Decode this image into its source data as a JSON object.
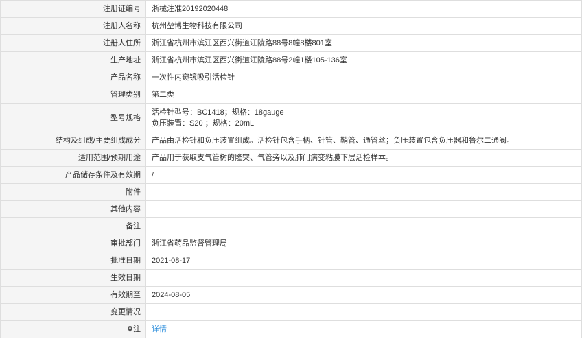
{
  "rows": [
    {
      "label": "注册证编号",
      "value": "浙械注准20192020448"
    },
    {
      "label": "注册人名称",
      "value": "杭州堃博生物科技有限公司"
    },
    {
      "label": "注册人住所",
      "value": "浙江省杭州市滨江区西兴街道江陵路88号8幢8楼801室"
    },
    {
      "label": "生产地址",
      "value": "浙江省杭州市滨江区西兴街道江陵路88号2幢1楼105-136室"
    },
    {
      "label": "产品名称",
      "value": "一次性内窥镜吸引活检针"
    },
    {
      "label": "管理类别",
      "value": "第二类"
    },
    {
      "label": "型号规格",
      "value_line1": "活检针型号：BC1418；规格：18gauge",
      "value_line2": "负压装置：S20 ；规格：20mL"
    },
    {
      "label": "结构及组成/主要组成成分",
      "value": "产品由活检针和负压装置组成。活检针包含手柄、针管、鞘管、通管丝；负压装置包含负压器和鲁尔二通阀。"
    },
    {
      "label": "适用范围/预期用途",
      "value": "产品用于获取支气管树的隆突、气管旁以及肺门病变粘膜下层活检样本。"
    },
    {
      "label": "产品储存条件及有效期",
      "value": "/"
    },
    {
      "label": "附件",
      "value": ""
    },
    {
      "label": "其他内容",
      "value": ""
    },
    {
      "label": "备注",
      "value": ""
    },
    {
      "label": "审批部门",
      "value": "浙江省药品监督管理局"
    },
    {
      "label": "批准日期",
      "value": "2021-08-17"
    },
    {
      "label": "生效日期",
      "value": ""
    },
    {
      "label": "有效期至",
      "value": "2024-08-05"
    },
    {
      "label": "变更情况",
      "value": ""
    },
    {
      "label": "注",
      "value": "详情",
      "icon": "pin-icon"
    }
  ],
  "colors": {
    "label_bg": "#f5f5f5",
    "border": "#dedede",
    "link": "#2f8fdc"
  }
}
